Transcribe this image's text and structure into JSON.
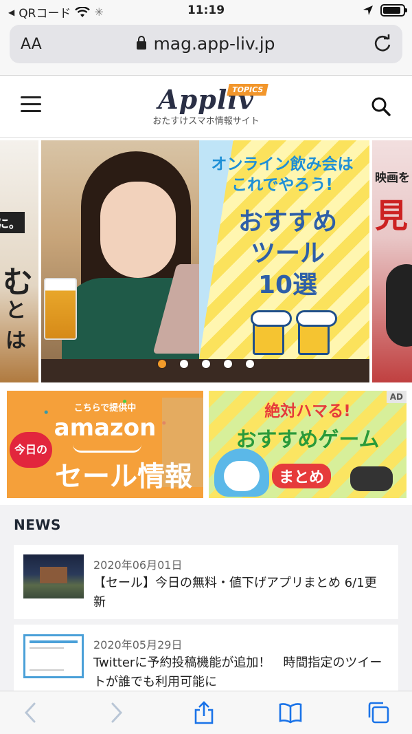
{
  "status_bar": {
    "back_app": "QRコード",
    "time": "11:19",
    "battery_level": 0.9
  },
  "browser": {
    "text_size_button": "AA",
    "url": "mag.app-liv.jp"
  },
  "site": {
    "logo": "Appliv",
    "logo_badge": "TOPICS",
    "tagline": "おたすけスマホ情報サイト"
  },
  "carousel": {
    "left_slide": {
      "tag": "に。",
      "big": "む",
      "mid": "とは"
    },
    "main_slide": {
      "headline": "オンライン飲み会は\nこれでやろう!",
      "title": "おすすめ\nツール\n10選"
    },
    "right_slide": {
      "top": "映画を",
      "big": "見"
    },
    "dot_count": 5,
    "active_index": 0
  },
  "banners": {
    "amazon": {
      "small": "こちらで提供中",
      "brand": "amazon",
      "today": "今日の",
      "sale": "セール情報"
    },
    "game": {
      "ad_label": "AD",
      "line1": "絶対ハマる!",
      "line2": "おすすめゲーム",
      "line3": "まとめ"
    }
  },
  "news": {
    "title": "NEWS",
    "items": [
      {
        "date": "2020年06月01日",
        "headline": "【セール】今日の無料・値下げアプリまとめ 6/1更新"
      },
      {
        "date": "2020年05月29日",
        "headline": "Twitterに予約投稿機能が追加！　時間指定のツイートが誰でも利用可能に"
      }
    ]
  },
  "toolbar": {
    "icons": [
      "back-icon",
      "forward-icon",
      "share-icon",
      "bookmarks-icon",
      "tabs-icon"
    ]
  },
  "colors": {
    "accent_orange": "#f29b2a",
    "logo_navy": "#2a2f45",
    "ios_blue": "#1a73e8"
  }
}
